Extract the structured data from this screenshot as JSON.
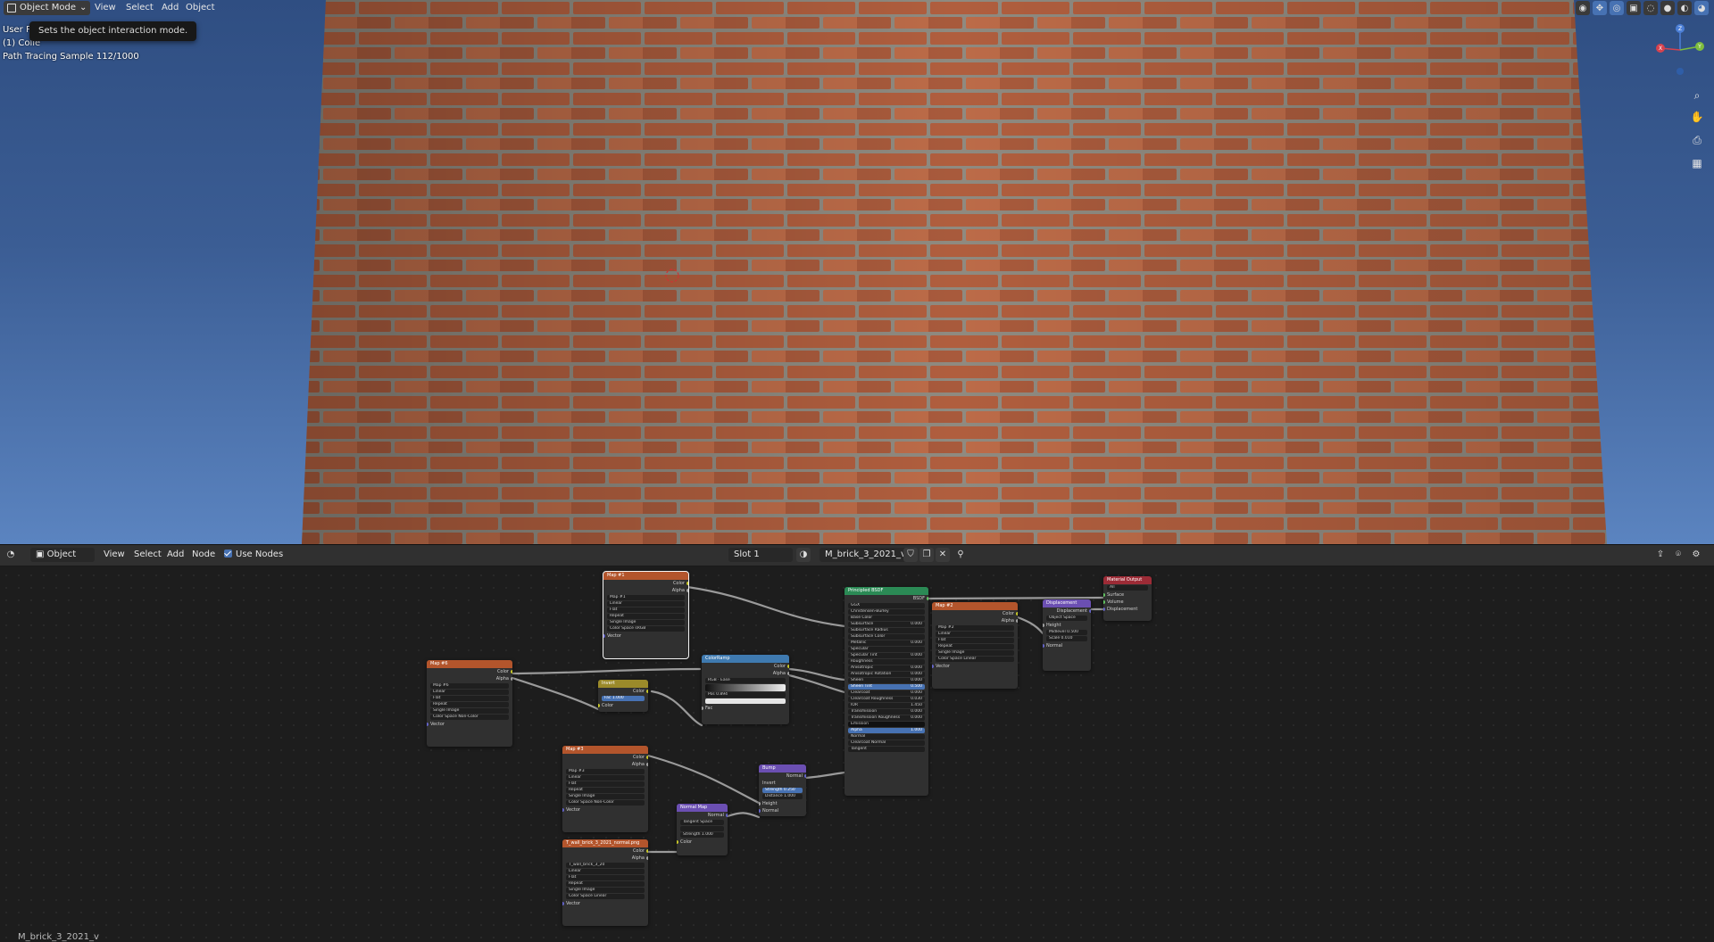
{
  "viewport": {
    "mode": "Object Mode",
    "menu": [
      "View",
      "Select",
      "Add",
      "Object"
    ],
    "tooltip": "Sets the object interaction mode.",
    "info": {
      "line1": "User Pers",
      "line2": "(1) Colle",
      "sample": "Path Tracing Sample 112/1000"
    },
    "gizmo": {
      "x": "X",
      "y": "Y",
      "z": "Z"
    },
    "icons": [
      "eye-icon",
      "gizmo-icon",
      "overlay-icon",
      "xray-icon",
      "wireframe-icon",
      "solid-icon",
      "material-icon",
      "rendered-icon"
    ]
  },
  "node_editor": {
    "editor_type": "Object",
    "menu": [
      "View",
      "Select",
      "Add",
      "Node"
    ],
    "use_nodes_label": "Use Nodes",
    "slot": "Slot 1",
    "material": "M_brick_3_2021_v",
    "footer": "M_brick_3_2021_v",
    "nodes": {
      "map1": {
        "title": "Map #1",
        "image": "Map #1",
        "outputs": [
          "Color",
          "Alpha"
        ],
        "interp": "Linear",
        "proj": "Flat",
        "ext": "Repeat",
        "src": "Single Image",
        "cs_label": "Color Space",
        "cs": "sRGB",
        "vector": "Vector"
      },
      "map6": {
        "title": "Map #6",
        "image": "Map #6",
        "outputs": [
          "Color",
          "Alpha"
        ],
        "interp": "Linear",
        "proj": "Flat",
        "ext": "Repeat",
        "src": "Single Image",
        "cs_label": "Color Space",
        "cs": "Non-Color",
        "vector": "Vector"
      },
      "invert": {
        "title": "Invert",
        "output": "Color",
        "fac": "Fac",
        "fac_val": "1.000",
        "color": "Color"
      },
      "colorramp": {
        "title": "ColorRamp",
        "outputs": [
          "Color",
          "Alpha"
        ],
        "mode": "RGB",
        "interp": "Ease",
        "pos": "Pos",
        "pos_val": "0.894",
        "fac": "Fac"
      },
      "map3": {
        "title": "Map #3",
        "image": "Map #3",
        "outputs": [
          "Color",
          "Alpha"
        ],
        "interp": "Linear",
        "proj": "Flat",
        "ext": "Repeat",
        "src": "Single Image",
        "cs_label": "Color Space",
        "cs": "Non-Color",
        "vector": "Vector"
      },
      "normalmap_tex": {
        "title": "T_wall_brick_3_2021_normal.png",
        "image": "T_wall_brick_3_20",
        "outputs": [
          "Color",
          "Alpha"
        ],
        "interp": "Linear",
        "proj": "Flat",
        "ext": "Repeat",
        "src": "Single Image",
        "cs_label": "Color Space",
        "cs": "Linear",
        "vector": "Vector"
      },
      "normalmap": {
        "title": "Normal Map",
        "output": "Normal",
        "space": "Tangent Space",
        "strength": "Strength",
        "strength_val": "1.000",
        "color": "Color"
      },
      "bump": {
        "title": "Bump",
        "output": "Normal",
        "invert": "Invert",
        "strength": "Strength",
        "strength_val": "0.250",
        "distance": "Distance",
        "distance_val": "1.000",
        "height": "Height",
        "normal": "Normal"
      },
      "bsdf": {
        "title": "Principled BSDF",
        "output": "BSDF",
        "dist": "GGX",
        "sss": "Christensen-Burley",
        "inputs": [
          {
            "label": "Base Color",
            "value": ""
          },
          {
            "label": "Subsurface",
            "value": "0.000"
          },
          {
            "label": "Subsurface Radius",
            "value": ""
          },
          {
            "label": "Subsurface Color",
            "value": ""
          },
          {
            "label": "Metallic",
            "value": "0.000"
          },
          {
            "label": "Specular",
            "value": ""
          },
          {
            "label": "Specular Tint",
            "value": "0.000"
          },
          {
            "label": "Roughness",
            "value": ""
          },
          {
            "label": "Anisotropic",
            "value": "0.000"
          },
          {
            "label": "Anisotropic Rotation",
            "value": "0.000"
          },
          {
            "label": "Sheen",
            "value": "0.000"
          },
          {
            "label": "Sheen Tint",
            "value": "0.500"
          },
          {
            "label": "Clearcoat",
            "value": "0.000"
          },
          {
            "label": "Clearcoat Roughness",
            "value": "0.030"
          },
          {
            "label": "IOR",
            "value": "1.450"
          },
          {
            "label": "Transmission",
            "value": "0.000"
          },
          {
            "label": "Transmission Roughness",
            "value": "0.000"
          },
          {
            "label": "Emission",
            "value": ""
          },
          {
            "label": "Alpha",
            "value": "1.000"
          },
          {
            "label": "Normal",
            "value": ""
          },
          {
            "label": "Clearcoat Normal",
            "value": ""
          },
          {
            "label": "Tangent",
            "value": ""
          }
        ]
      },
      "map2": {
        "title": "Map #2",
        "image": "Map #2",
        "outputs": [
          "Color",
          "Alpha"
        ],
        "interp": "Linear",
        "proj": "Flat",
        "ext": "Repeat",
        "src": "Single Image",
        "cs_label": "Color Space",
        "cs": "Linear",
        "vector": "Vector"
      },
      "displacement": {
        "title": "Displacement",
        "output": "Displacement",
        "space": "Object Space",
        "height": "Height",
        "midlevel": "Midlevel",
        "midlevel_val": "0.500",
        "scale": "Scale",
        "scale_val": "0.010",
        "normal": "Normal"
      },
      "output": {
        "title": "Material Output",
        "target": "All",
        "surface": "Surface",
        "volume": "Volume",
        "displacement": "Displacement"
      }
    }
  }
}
